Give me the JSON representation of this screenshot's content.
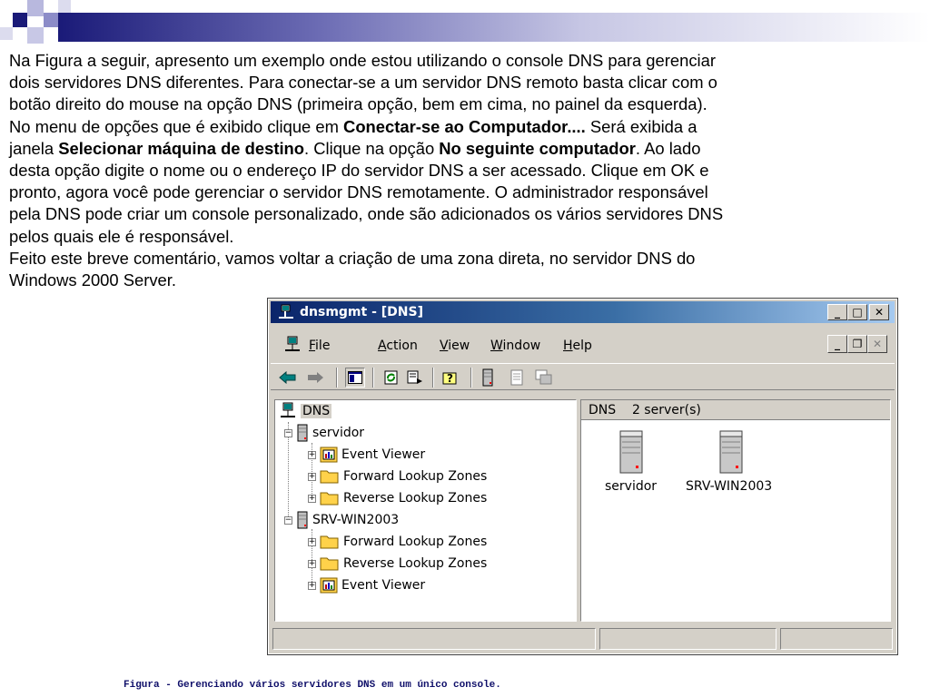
{
  "paragraph": {
    "l1": "Na Figura a seguir, apresento um exemplo onde estou utilizando o console DNS para gerenciar",
    "l2": "dois servidores DNS diferentes. Para conectar-se a um servidor DNS remoto basta clicar com o",
    "l3": "botão direito do mouse na opção DNS (primeira opção, bem em cima, no painel da esquerda).",
    "l4a": "No menu de opções que é exibido clique em ",
    "l4b": "Conectar-se ao Computador....",
    "l4c": " Será exibida a",
    "l5a": "janela ",
    "l5b": "Selecionar máquina de destino",
    "l5c": ". Clique na opção ",
    "l5d": "No seguinte computador",
    "l5e": ". Ao lado",
    "l6": "desta opção digite o nome ou o endereço IP do servidor DNS a ser acessado. Clique em OK e",
    "l7": "pronto, agora você pode gerenciar o servidor DNS remotamente. O administrador responsável",
    "l8": "pela DNS pode criar um console personalizado, onde são adicionados os vários servidores DNS",
    "l9": "pelos quais ele é responsável.",
    "l10": "Feito este breve comentário, vamos voltar a criação de uma zona direta, no servidor DNS do",
    "l11": "Windows 2000 Server."
  },
  "caption": "Figura - Gerenciando vários servidores DNS em um único console.",
  "window": {
    "title": "dnsmgmt - [DNS]",
    "menu": [
      {
        "accel": "F",
        "rest": "ile"
      },
      {
        "accel": "A",
        "rest": "ction"
      },
      {
        "accel": "V",
        "rest": "iew"
      },
      {
        "accel": "W",
        "rest": "indow"
      },
      {
        "accel": "H",
        "rest": "elp"
      }
    ],
    "tree": {
      "root": "DNS",
      "server1": "servidor",
      "s1_items": [
        "Event Viewer",
        "Forward Lookup Zones",
        "Reverse Lookup Zones"
      ],
      "server2": "SRV-WIN2003",
      "s2_items": [
        "Forward Lookup Zones",
        "Reverse Lookup Zones",
        "Event Viewer"
      ]
    },
    "right_header": "DNS    2 server(s)",
    "servers": [
      "servidor",
      "SRV-WIN2003"
    ]
  },
  "colors": {
    "title_start": "#0a246a",
    "title_end": "#a6caf0",
    "face": "#d4d0c8",
    "slide_accent": "#1a1a78"
  }
}
